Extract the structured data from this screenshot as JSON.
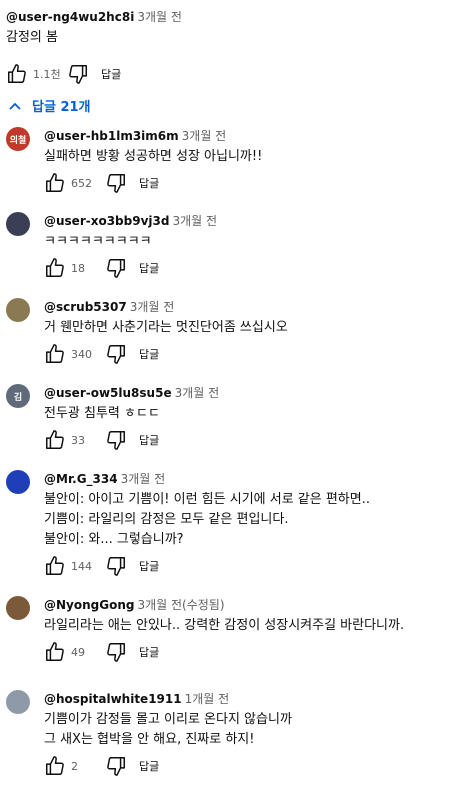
{
  "top_comment": {
    "author": "@user-ng4wu2hc8i",
    "time": "3개월 전",
    "text": "감정의 봄",
    "likes": "1.1천",
    "reply_label": "답글"
  },
  "replies_toggle": {
    "label": "답글 21개",
    "color": "#065fd4"
  },
  "replies": [
    {
      "avatar_text": "의철",
      "avatar_color": "#c0392b",
      "author": "@user-hb1lm3im6m",
      "time": "3개월 전",
      "lines": [
        "실패하면 방황 성공하면 성장 아닙니까!!"
      ],
      "likes": "652",
      "reply_label": "답글"
    },
    {
      "avatar_text": "",
      "avatar_color": "#3a3f55",
      "author": "@user-xo3bb9vj3d",
      "time": "3개월 전",
      "lines": [
        "ㅋㅋㅋㅋㅋㅋㅋㅋㅋ"
      ],
      "likes": "18",
      "reply_label": "답글"
    },
    {
      "avatar_text": "",
      "avatar_color": "#8a7a52",
      "author": "@scrub5307",
      "time": "3개월 전",
      "lines": [
        "거 웬만하면 사춘기라는 멋진단어좀 쓰십시오"
      ],
      "likes": "340",
      "reply_label": "답글"
    },
    {
      "avatar_text": "김",
      "avatar_color": "#5f6b7a",
      "author": "@user-ow5lu8su5e",
      "time": "3개월 전",
      "lines": [
        "전두광 침투력 ㅎㄷㄷ"
      ],
      "likes": "33",
      "reply_label": "답글"
    },
    {
      "avatar_text": "",
      "avatar_color": "#1f3fb8",
      "author": "@Mr.G_334",
      "time": "3개월 전",
      "lines": [
        "불안이: 아이고 기쁨이! 이런 힘든 시기에 서로 같은 편하면..",
        "기쁨이: 라일리의 감정은 모두 같은 편입니다.",
        "불안이: 와... 그렇습니까?"
      ],
      "likes": "144",
      "reply_label": "답글"
    },
    {
      "avatar_text": "",
      "avatar_color": "#7b5a3a",
      "author": "@NyongGong",
      "time": "3개월 전(수정됨)",
      "lines": [
        "라일리라는 애는 안있나.. 강력한 감정이 성장시켜주길 바란다니까."
      ],
      "likes": "49",
      "reply_label": "답글"
    },
    {
      "avatar_text": "",
      "avatar_color": "#8e9aa8",
      "author": "@hospitalwhite1911",
      "time": "1개월 전",
      "lines": [
        "기쁨이가 감정들 몰고 이리로 온다지 않습니까",
        "그 새X는 협박을 안 해요, 진짜로 하지!"
      ],
      "likes": "2",
      "reply_label": "답글"
    }
  ]
}
